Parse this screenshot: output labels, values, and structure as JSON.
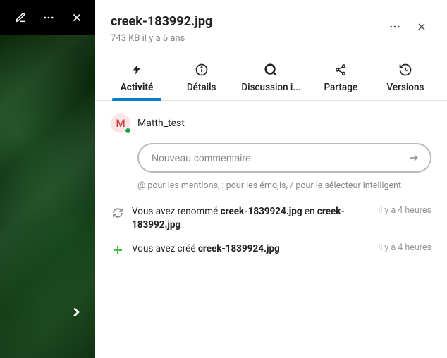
{
  "file": {
    "name": "creek-183992.jpg",
    "size": "743 KB",
    "age": "il y a 6 ans"
  },
  "tabs": {
    "activity": "Activité",
    "details": "Détails",
    "discussion": "Discussion i...",
    "share": "Partage",
    "versions": "Versions"
  },
  "author": {
    "initial": "M",
    "name": "Matth_test"
  },
  "comment": {
    "placeholder": "Nouveau commentaire",
    "hint": "@ pour les mentions, : pour les émojis, / pour le sélecteur intelligent"
  },
  "activity": [
    {
      "prefix": "Vous avez renommé ",
      "bold1": "creek-1839924.jpg",
      "middle": " en ",
      "bold2": "creek-183992.jpg",
      "time": "il y a 4 heures",
      "icon": "rename"
    },
    {
      "prefix": "Vous avez créé ",
      "bold1": "creek-1839924.jpg",
      "middle": "",
      "bold2": "",
      "time": "il y a 4 heures",
      "icon": "create"
    }
  ]
}
